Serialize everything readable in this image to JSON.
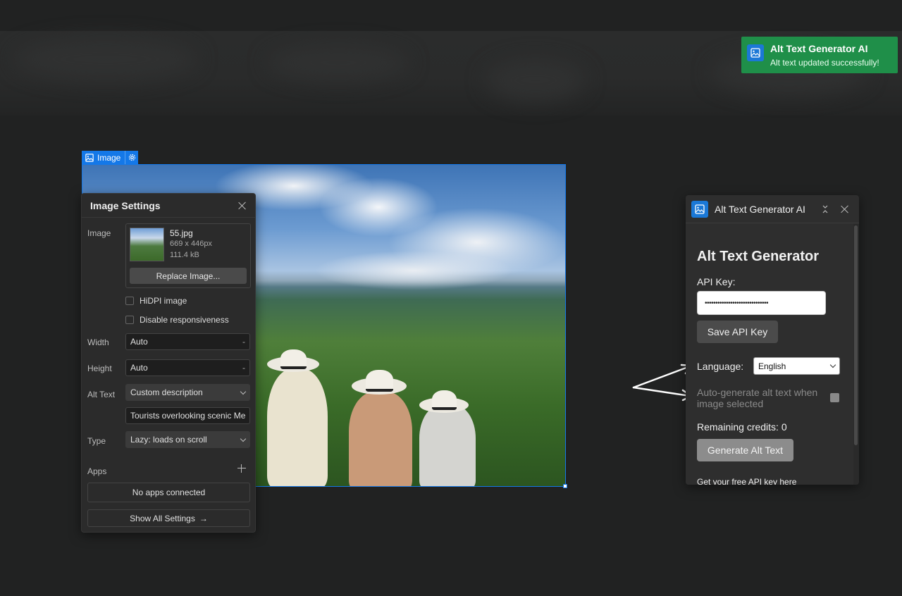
{
  "toast": {
    "title": "Alt Text Generator AI",
    "message": "Alt text updated successfully!",
    "icon": "image-icon",
    "color": "#1f8f49"
  },
  "canvas_element": {
    "label": "Image",
    "icon": "image-icon",
    "settings_icon": "gear-icon",
    "accent": "#1478e8"
  },
  "image_settings": {
    "title": "Image Settings",
    "image_label": "Image",
    "file": {
      "name": "55.jpg",
      "dimensions": "669 x 446px",
      "size": "111.4 kB"
    },
    "replace_label": "Replace Image...",
    "hidpi_label": "HiDPI image",
    "disable_responsive_label": "Disable responsiveness",
    "width_label": "Width",
    "width_value": "Auto",
    "height_label": "Height",
    "height_value": "Auto",
    "field_suffix": "-",
    "alt_text_label": "Alt Text",
    "alt_text_mode": "Custom description",
    "alt_text_value": "Tourists overlooking scenic Me",
    "type_label": "Type",
    "type_value": "Lazy: loads on scroll",
    "apps_label": "Apps",
    "no_apps_label": "No apps connected",
    "show_all_label": "Show All Settings",
    "show_all_arrow": "→"
  },
  "generator": {
    "title": "Alt Text Generator AI",
    "heading": "Alt Text Generator",
    "api_key_label": "API Key:",
    "api_key_value": "••••••••••••••••••••••••••••••",
    "save_label": "Save API Key",
    "language_label": "Language:",
    "language_value": "English",
    "auto_label": "Auto-generate alt text when image selected",
    "credits_label": "Remaining credits: 0",
    "generate_label": "Generate Alt Text",
    "link_label": "Get your free API key here",
    "icon_color": "#1b78d6"
  }
}
